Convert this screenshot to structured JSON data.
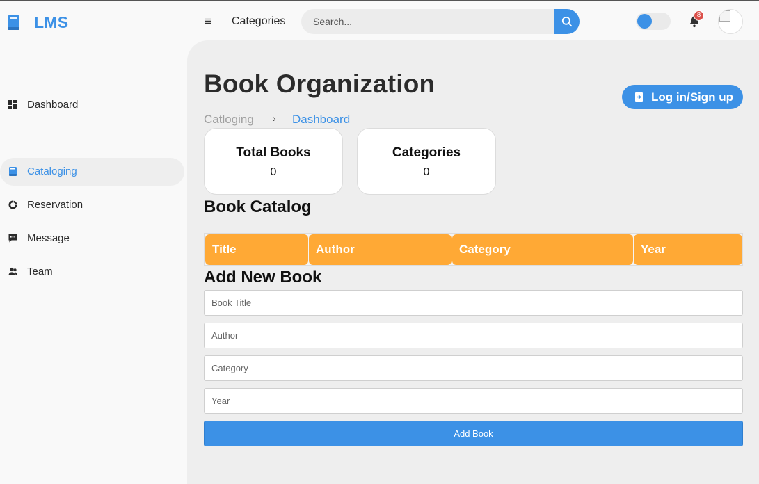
{
  "app": {
    "name": "LMS"
  },
  "topbar": {
    "nav_link": "Categories",
    "search": {
      "placeholder": "Search...",
      "value": ""
    },
    "notifications_count": "8",
    "theme_toggle": {
      "state": "off"
    }
  },
  "sidebar": {
    "items": [
      {
        "label": "Dashboard",
        "icon": "dashboard-icon",
        "active": false
      },
      {
        "label": "Cataloging",
        "icon": "book-icon",
        "active": true
      },
      {
        "label": "Reservation",
        "icon": "doughnut-icon",
        "active": false
      },
      {
        "label": "Message",
        "icon": "message-icon",
        "active": false
      },
      {
        "label": "Team",
        "icon": "group-icon",
        "active": false
      }
    ]
  },
  "main": {
    "title": "Book Organization",
    "login_button": "Log in/Sign up",
    "breadcrumb": {
      "first": "Catloging",
      "separator": "›",
      "current": "Dashboard"
    },
    "stats": [
      {
        "label": "Total Books",
        "value": "0"
      },
      {
        "label": "Categories",
        "value": "0"
      }
    ],
    "catalog": {
      "heading": "Book Catalog",
      "columns": [
        "Title",
        "Author",
        "Category",
        "Year"
      ]
    },
    "form": {
      "heading": "Add New Book",
      "fields": [
        {
          "placeholder": "Book Title",
          "value": ""
        },
        {
          "placeholder": "Author",
          "value": ""
        },
        {
          "placeholder": "Category",
          "value": ""
        },
        {
          "placeholder": "Year",
          "value": ""
        }
      ],
      "submit_label": "Add Book"
    }
  },
  "colors": {
    "accent": "#3c91e6",
    "table_header": "#ffa935",
    "badge": "#db504a",
    "content_bg": "#eeeeee",
    "sidebar_bg": "#f9f9f9"
  }
}
